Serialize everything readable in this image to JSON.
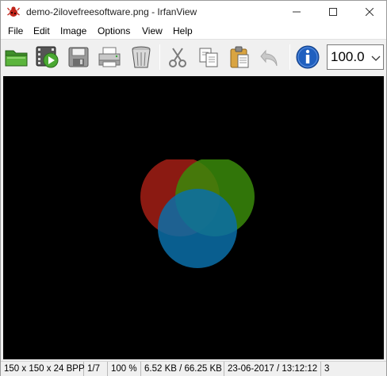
{
  "window": {
    "title": "demo-2ilovefreesoftware.png - IrfanView",
    "min_glyph": "minimize",
    "max_glyph": "maximize",
    "close_glyph": "close"
  },
  "menu": {
    "items": [
      "File",
      "Edit",
      "Image",
      "Options",
      "View",
      "Help"
    ]
  },
  "toolbar": {
    "buttons": [
      {
        "name": "open-icon"
      },
      {
        "name": "slideshow-icon"
      },
      {
        "name": "save-icon"
      },
      {
        "name": "print-icon"
      },
      {
        "name": "delete-icon"
      },
      {
        "name": "cut-icon"
      },
      {
        "name": "copy-icon"
      },
      {
        "name": "paste-icon"
      },
      {
        "name": "undo-icon"
      },
      {
        "name": "info-icon"
      }
    ],
    "zoom": {
      "value": "100.0",
      "arrow_icon": "chevron-down-icon"
    }
  },
  "image": {
    "background": "#000000",
    "circles": [
      {
        "color": "#8b1a12",
        "label": "red"
      },
      {
        "color": "#3a8a0a",
        "label": "green"
      },
      {
        "color": "#0a6fa8",
        "label": "blue"
      }
    ]
  },
  "status": {
    "dimensions": "150 x 150 x 24 BPP",
    "index": "1/7",
    "zoom": "100 %",
    "size": "6.52 KB / 66.25 KB",
    "datetime": "23-06-2017 / 13:12:12",
    "extra": "3"
  },
  "colors": {
    "titlebar_bg": "#ffffff",
    "toolbar_bg": "#f0f0f0",
    "canvas_bg": "#000000",
    "info_blue": "#1f5fbf"
  }
}
